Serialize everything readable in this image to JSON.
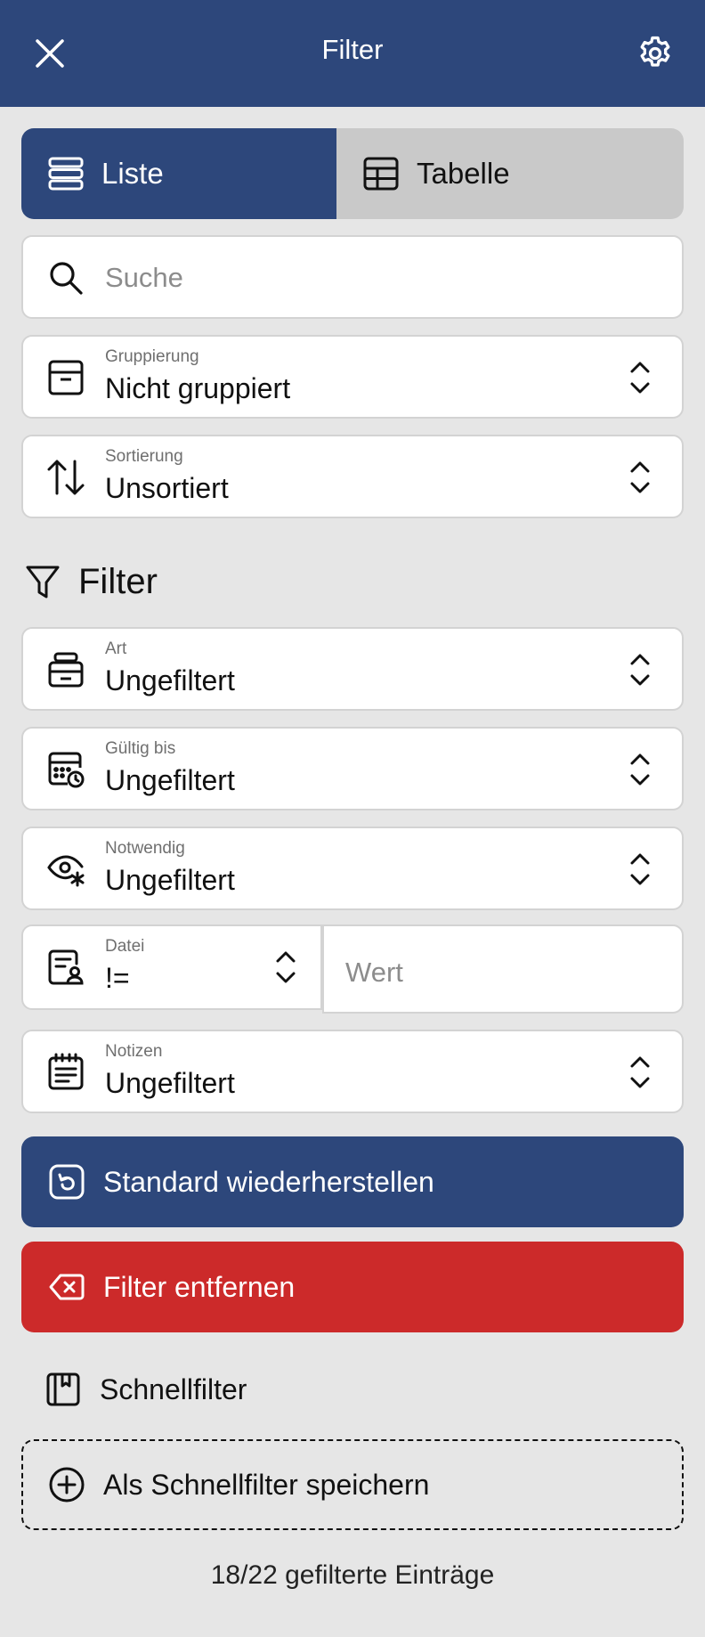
{
  "header": {
    "title": "Filter",
    "close_icon": "close-icon",
    "settings_icon": "gear-icon"
  },
  "view_toggle": {
    "options": [
      {
        "label": "Liste",
        "icon": "list-icon",
        "active": true
      },
      {
        "label": "Tabelle",
        "icon": "table-icon",
        "active": false
      }
    ]
  },
  "search": {
    "placeholder": "Suche",
    "icon": "search-icon"
  },
  "grouping": {
    "label": "Gruppierung",
    "value": "Nicht gruppiert",
    "icon": "archive-box-icon"
  },
  "sorting": {
    "label": "Sortierung",
    "value": "Unsortiert",
    "icon": "sort-arrows-icon"
  },
  "filter_section": {
    "title": "Filter",
    "icon": "funnel-icon",
    "fields": [
      {
        "label": "Art",
        "value": "Ungefiltert",
        "icon": "stack-icon"
      },
      {
        "label": "Gültig bis",
        "value": "Ungefiltert",
        "icon": "calendar-clock-icon"
      },
      {
        "label": "Notwendig",
        "value": "Ungefiltert",
        "icon": "eye-asterisk-icon"
      },
      {
        "label": "Datei",
        "value": "!=",
        "icon": "file-person-icon",
        "value_placeholder": "Wert"
      },
      {
        "label": "Notizen",
        "value": "Ungefiltert",
        "icon": "notes-icon"
      }
    ]
  },
  "actions": {
    "restore_label": "Standard wiederherstellen",
    "remove_label": "Filter entfernen"
  },
  "quick_filter": {
    "title": "Schnellfilter",
    "save_label": "Als Schnellfilter speichern"
  },
  "footer": {
    "count_text": "18/22 gefilterte Einträge"
  },
  "colors": {
    "primary": "#2d477b",
    "danger": "#cc2a2a",
    "background": "#e6e6e6"
  }
}
